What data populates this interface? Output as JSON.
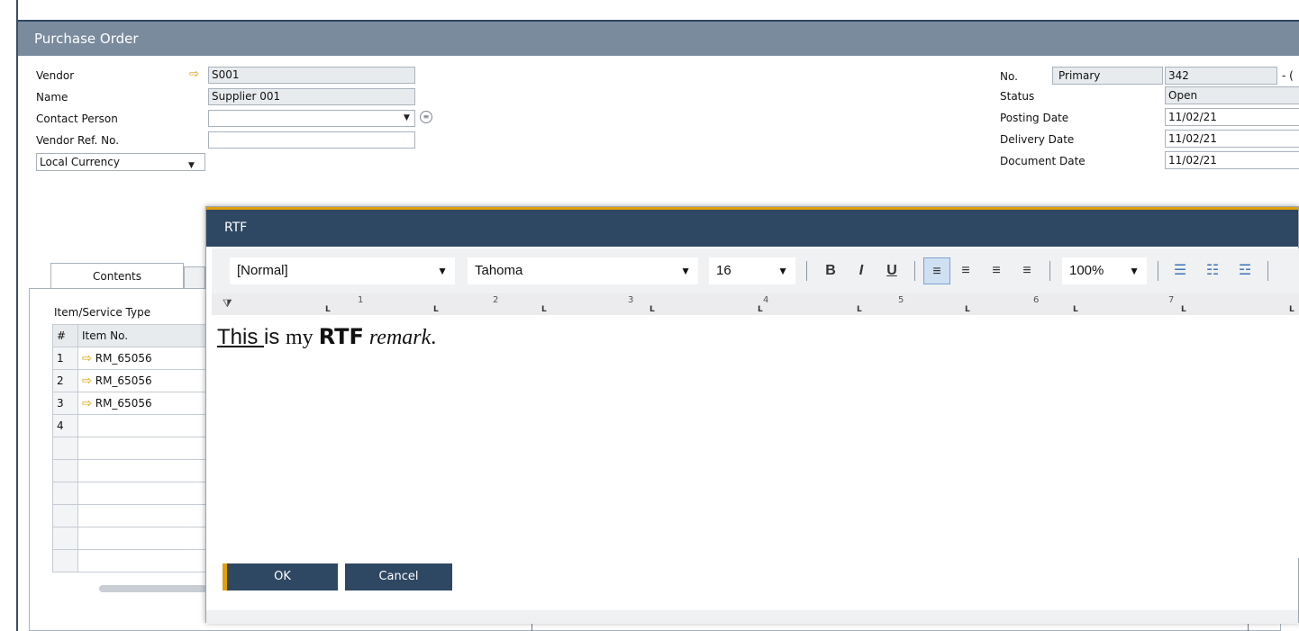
{
  "window": {
    "title": "Purchase Order"
  },
  "header_left": {
    "vendor": {
      "label": "Vendor",
      "value": "S001"
    },
    "name": {
      "label": "Name",
      "value": "Supplier 001"
    },
    "contact_person": {
      "label": "Contact Person",
      "value": ""
    },
    "vendor_ref": {
      "label": "Vendor Ref. No.",
      "value": ""
    },
    "currency": {
      "value": "Local Currency"
    }
  },
  "header_right": {
    "no": {
      "label": "No.",
      "series": "Primary",
      "value": "342",
      "suffix": "- ("
    },
    "status": {
      "label": "Status",
      "value": "Open"
    },
    "posting_date": {
      "label": "Posting Date",
      "value": "11/02/21"
    },
    "delivery_date": {
      "label": "Delivery Date",
      "value": "11/02/21"
    },
    "document_date": {
      "label": "Document Date",
      "value": "11/02/21"
    }
  },
  "tabs": [
    {
      "label": "Contents"
    }
  ],
  "grid": {
    "type_label": "Item/Service Type",
    "columns": [
      "#",
      "Item No."
    ],
    "rows": [
      {
        "num": "1",
        "item": "RM_65056"
      },
      {
        "num": "2",
        "item": "RM_65056"
      },
      {
        "num": "3",
        "item": "RM_65056"
      },
      {
        "num": "4",
        "item": ""
      }
    ]
  },
  "rtf_dialog": {
    "title": "RTF",
    "style_select": "[Normal]",
    "font_select": "Tahoma",
    "size_select": "16",
    "bold": "B",
    "italic": "I",
    "underline": "U",
    "zoom_select": "100%",
    "ruler_numbers": [
      "1",
      "2",
      "3",
      "4",
      "5",
      "6",
      "7"
    ],
    "content": {
      "part1": "This ",
      "part2": "is ",
      "part3": "my ",
      "part4": "RTF",
      "part5": " ",
      "part6": "remark",
      "part7": "."
    },
    "ok_label": "OK",
    "cancel_label": "Cancel"
  },
  "colors": {
    "title_bar": "#7a8b9d",
    "dialog_header": "#2e4762",
    "accent": "#e0a00c",
    "link_arrow": "#e0a00c"
  }
}
